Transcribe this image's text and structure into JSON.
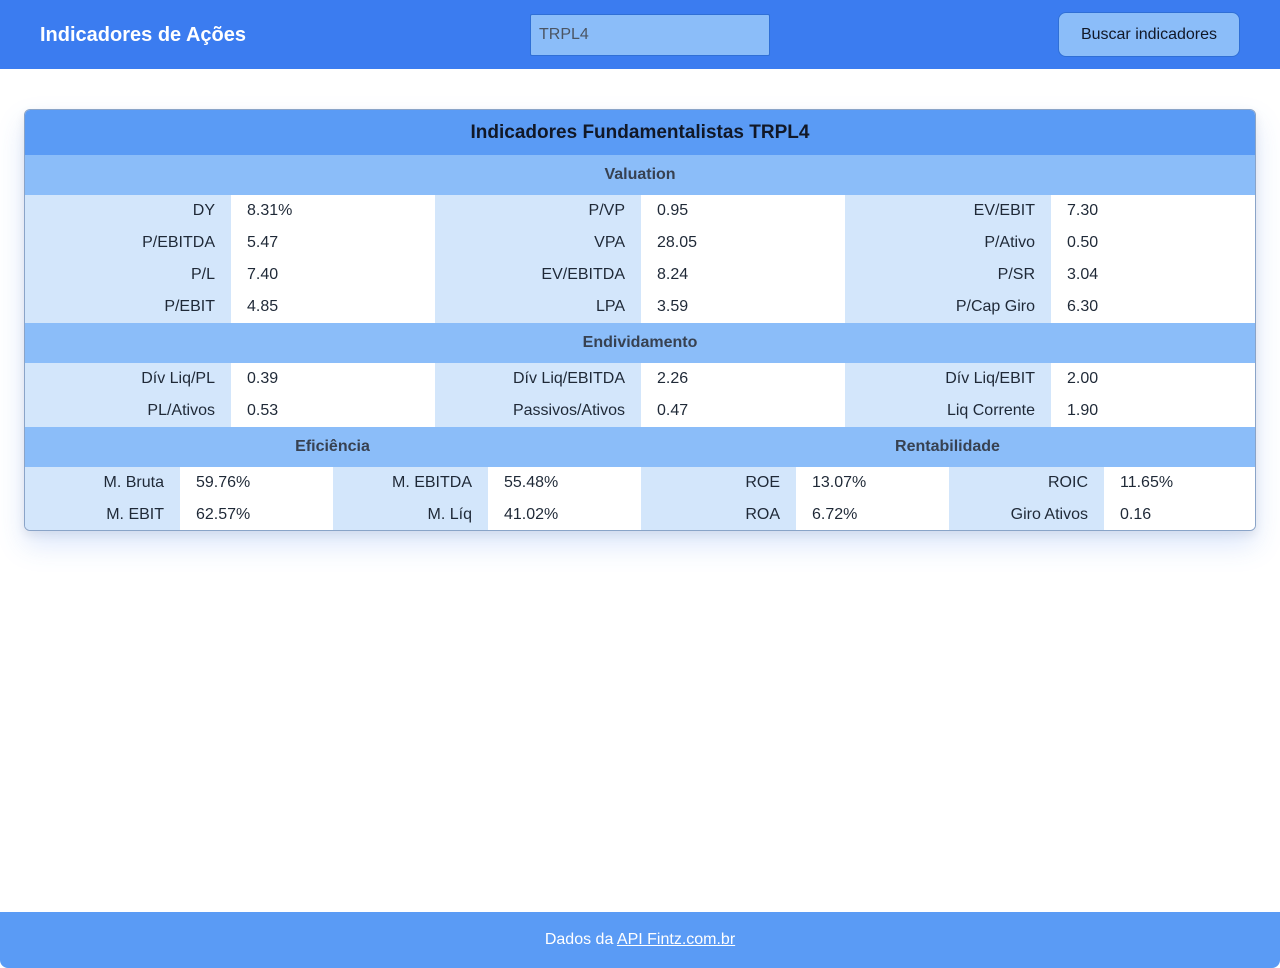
{
  "header": {
    "title": "Indicadores de Ações",
    "ticker_value": "TRPL4",
    "search_button": "Buscar indicadores"
  },
  "card": {
    "title": "Indicadores Fundamentalistas TRPL4",
    "valuation": {
      "heading": "Valuation",
      "rows": [
        [
          [
            "DY",
            "8.31%"
          ],
          [
            "P/VP",
            "0.95"
          ],
          [
            "EV/EBIT",
            "7.30"
          ]
        ],
        [
          [
            "P/EBITDA",
            "5.47"
          ],
          [
            "VPA",
            "28.05"
          ],
          [
            "P/Ativo",
            "0.50"
          ]
        ],
        [
          [
            "P/L",
            "7.40"
          ],
          [
            "EV/EBITDA",
            "8.24"
          ],
          [
            "P/SR",
            "3.04"
          ]
        ],
        [
          [
            "P/EBIT",
            "4.85"
          ],
          [
            "LPA",
            "3.59"
          ],
          [
            "P/Cap Giro",
            "6.30"
          ]
        ]
      ]
    },
    "endividamento": {
      "heading": "Endividamento",
      "rows": [
        [
          [
            "Dív Liq/PL",
            "0.39"
          ],
          [
            "Dív Liq/EBITDA",
            "2.26"
          ],
          [
            "Dív Liq/EBIT",
            "2.00"
          ]
        ],
        [
          [
            "PL/Ativos",
            "0.53"
          ],
          [
            "Passivos/Ativos",
            "0.47"
          ],
          [
            "Liq Corrente",
            "1.90"
          ]
        ]
      ]
    },
    "eficiencia_heading": "Eficiência",
    "rentabilidade_heading": "Rentabilidade",
    "efic_rent_rows": [
      [
        [
          "M. Bruta",
          "59.76%"
        ],
        [
          "M. EBITDA",
          "55.48%"
        ],
        [
          "ROE",
          "13.07%"
        ],
        [
          "ROIC",
          "11.65%"
        ]
      ],
      [
        [
          "M. EBIT",
          "62.57%"
        ],
        [
          "M. Líq",
          "41.02%"
        ],
        [
          "ROA",
          "6.72%"
        ],
        [
          "Giro Ativos",
          "0.16"
        ]
      ]
    ]
  },
  "footer": {
    "prefix": "Dados da",
    "link_label": "API Fintz.com.br"
  },
  "colors": {
    "topbar": "#3b7cf0",
    "accent": "#5a9bf5",
    "section": "#8bbdf9",
    "label_cell": "#d3e6fb"
  }
}
